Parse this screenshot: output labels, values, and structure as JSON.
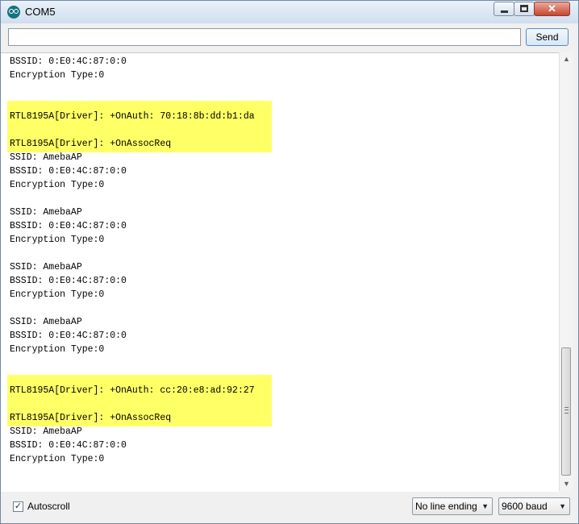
{
  "window": {
    "title": "COM5",
    "icon": "arduino-icon"
  },
  "toolbar": {
    "input_value": "",
    "send_label": "Send"
  },
  "output": {
    "highlight_color": "#ffff66",
    "lines": [
      "BSSID: 0:E0:4C:87:0:0",
      "Encryption Type:0",
      "",
      "",
      "RTL8195A[Driver]: +OnAuth: 70:18:8b:dd:b1:da",
      "",
      "RTL8195A[Driver]: +OnAssocReq",
      "SSID: AmebaAP",
      "BSSID: 0:E0:4C:87:0:0",
      "Encryption Type:0",
      "",
      "SSID: AmebaAP",
      "BSSID: 0:E0:4C:87:0:0",
      "Encryption Type:0",
      "",
      "SSID: AmebaAP",
      "BSSID: 0:E0:4C:87:0:0",
      "Encryption Type:0",
      "",
      "SSID: AmebaAP",
      "BSSID: 0:E0:4C:87:0:0",
      "Encryption Type:0",
      "",
      "",
      "RTL8195A[Driver]: +OnAuth: cc:20:e8:ad:92:27",
      "",
      "RTL8195A[Driver]: +OnAssocReq",
      "SSID: AmebaAP",
      "BSSID: 0:E0:4C:87:0:0",
      "Encryption Type:0"
    ]
  },
  "statusbar": {
    "autoscroll_label": "Autoscroll",
    "autoscroll_checked": true,
    "line_ending": "No line ending",
    "baud": "9600 baud"
  }
}
